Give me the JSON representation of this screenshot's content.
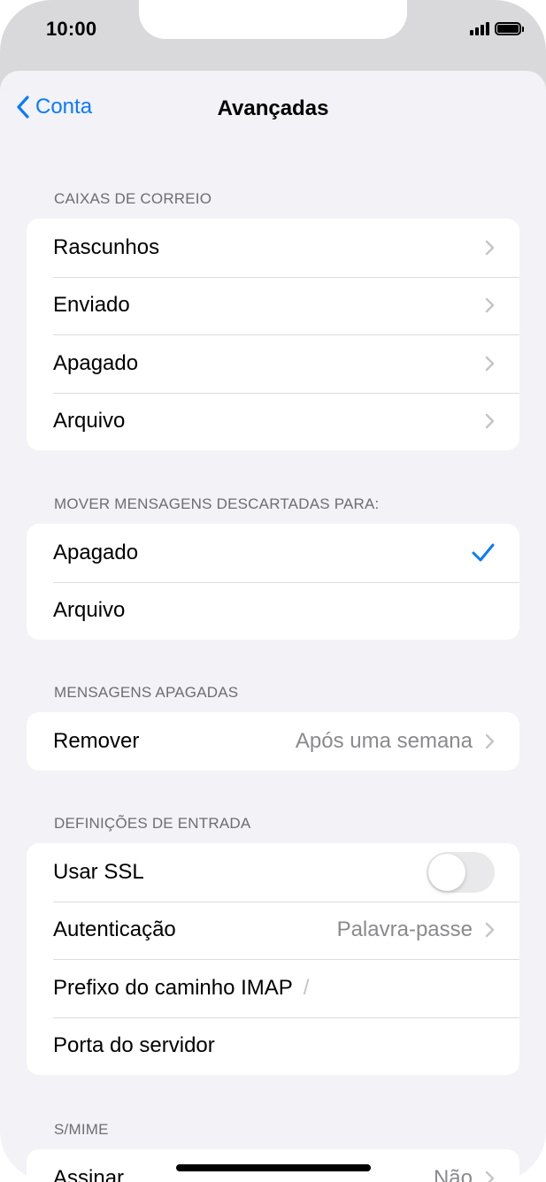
{
  "status_bar": {
    "time": "10:00",
    "signal_icon": "signal-bars-icon",
    "battery_icon": "battery-icon"
  },
  "nav": {
    "back_label": "Conta",
    "title": "Avançadas"
  },
  "colors": {
    "accent": "#0a7aff",
    "background": "#f2f2f7",
    "secondary_text": "#8a8a8e",
    "header_text": "#6d6d72"
  },
  "sections": {
    "mailboxes": {
      "header": "CAIXAS DE CORREIO",
      "items": [
        {
          "label": "Rascunhos"
        },
        {
          "label": "Enviado"
        },
        {
          "label": "Apagado"
        },
        {
          "label": "Arquivo"
        }
      ]
    },
    "move_discarded": {
      "header": "MOVER MENSAGENS DESCARTADAS PARA:",
      "items": [
        {
          "label": "Apagado",
          "selected": true
        },
        {
          "label": "Arquivo",
          "selected": false
        }
      ]
    },
    "deleted_messages": {
      "header": "MENSAGENS APAGADAS",
      "items": [
        {
          "label": "Remover",
          "value": "Após uma semana"
        }
      ]
    },
    "incoming": {
      "header": "DEFINIÇÕES DE ENTRADA",
      "use_ssl": {
        "label": "Usar SSL",
        "on": false
      },
      "authentication": {
        "label": "Autenticação",
        "value": "Palavra-passe"
      },
      "imap_prefix": {
        "label": "Prefixo do caminho IMAP",
        "value": "/"
      },
      "server_port": {
        "label": "Porta do servidor"
      }
    },
    "smime": {
      "header": "S/MIME",
      "items": [
        {
          "label": "Assinar",
          "value": "Não"
        }
      ]
    }
  }
}
